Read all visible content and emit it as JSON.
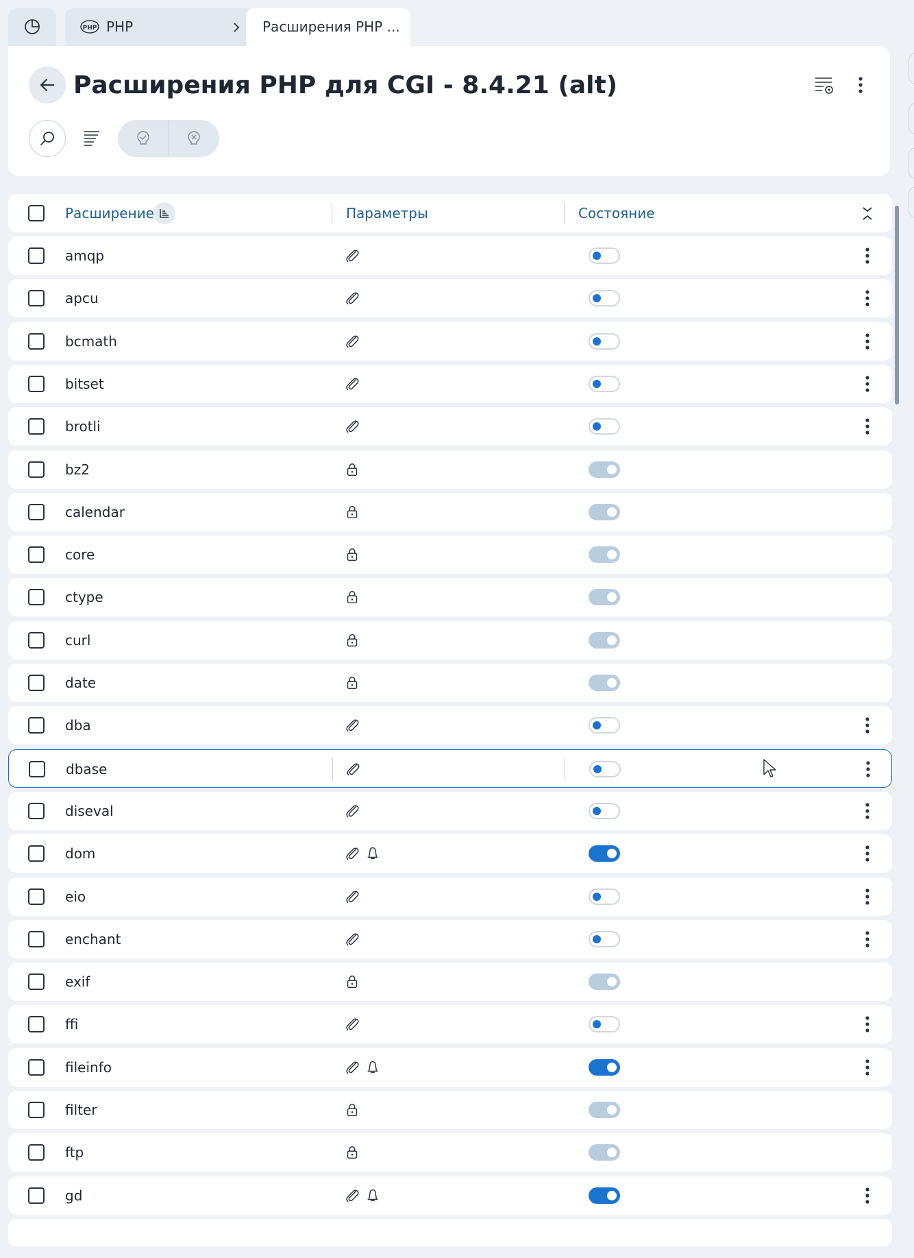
{
  "tabs": {
    "home_icon": "chart-pie-icon",
    "php_label": "PHP",
    "active_label": "Расширения PHP ..."
  },
  "header": {
    "title": "Расширения PHP для CGI - 8.4.21 (alt)"
  },
  "table": {
    "columns": {
      "extension": "Расширение",
      "parameters": "Параметры",
      "state": "Состояние"
    },
    "rows": [
      {
        "name": "amqp",
        "param": "clip",
        "state": "off",
        "menu": true
      },
      {
        "name": "apcu",
        "param": "clip",
        "state": "off",
        "menu": true
      },
      {
        "name": "bcmath",
        "param": "clip",
        "state": "off",
        "menu": true
      },
      {
        "name": "bitset",
        "param": "clip",
        "state": "off",
        "menu": true
      },
      {
        "name": "brotli",
        "param": "clip",
        "state": "off",
        "menu": true
      },
      {
        "name": "bz2",
        "param": "lock",
        "state": "locked",
        "menu": false
      },
      {
        "name": "calendar",
        "param": "lock",
        "state": "locked",
        "menu": false
      },
      {
        "name": "core",
        "param": "lock",
        "state": "locked",
        "menu": false
      },
      {
        "name": "ctype",
        "param": "lock",
        "state": "locked",
        "menu": false
      },
      {
        "name": "curl",
        "param": "lock",
        "state": "locked",
        "menu": false
      },
      {
        "name": "date",
        "param": "lock",
        "state": "locked",
        "menu": false
      },
      {
        "name": "dba",
        "param": "clip",
        "state": "off",
        "menu": true
      },
      {
        "name": "dbase",
        "param": "clip",
        "state": "off",
        "menu": true,
        "selected": true
      },
      {
        "name": "diseval",
        "param": "clip",
        "state": "off",
        "menu": true
      },
      {
        "name": "dom",
        "param": "clip+bell",
        "state": "on",
        "menu": true
      },
      {
        "name": "eio",
        "param": "clip",
        "state": "off",
        "menu": true
      },
      {
        "name": "enchant",
        "param": "clip",
        "state": "off",
        "menu": true
      },
      {
        "name": "exif",
        "param": "lock",
        "state": "locked",
        "menu": false
      },
      {
        "name": "ffi",
        "param": "clip",
        "state": "off",
        "menu": true
      },
      {
        "name": "fileinfo",
        "param": "clip+bell",
        "state": "on",
        "menu": true
      },
      {
        "name": "filter",
        "param": "lock",
        "state": "locked",
        "menu": false
      },
      {
        "name": "ftp",
        "param": "lock",
        "state": "locked",
        "menu": false
      },
      {
        "name": "gd",
        "param": "clip+bell",
        "state": "on",
        "menu": true
      }
    ]
  },
  "colors": {
    "accent": "#1a73d0",
    "header_text": "#1e5f98",
    "background": "#eef2f7",
    "locked_toggle": "#b9cddf"
  }
}
